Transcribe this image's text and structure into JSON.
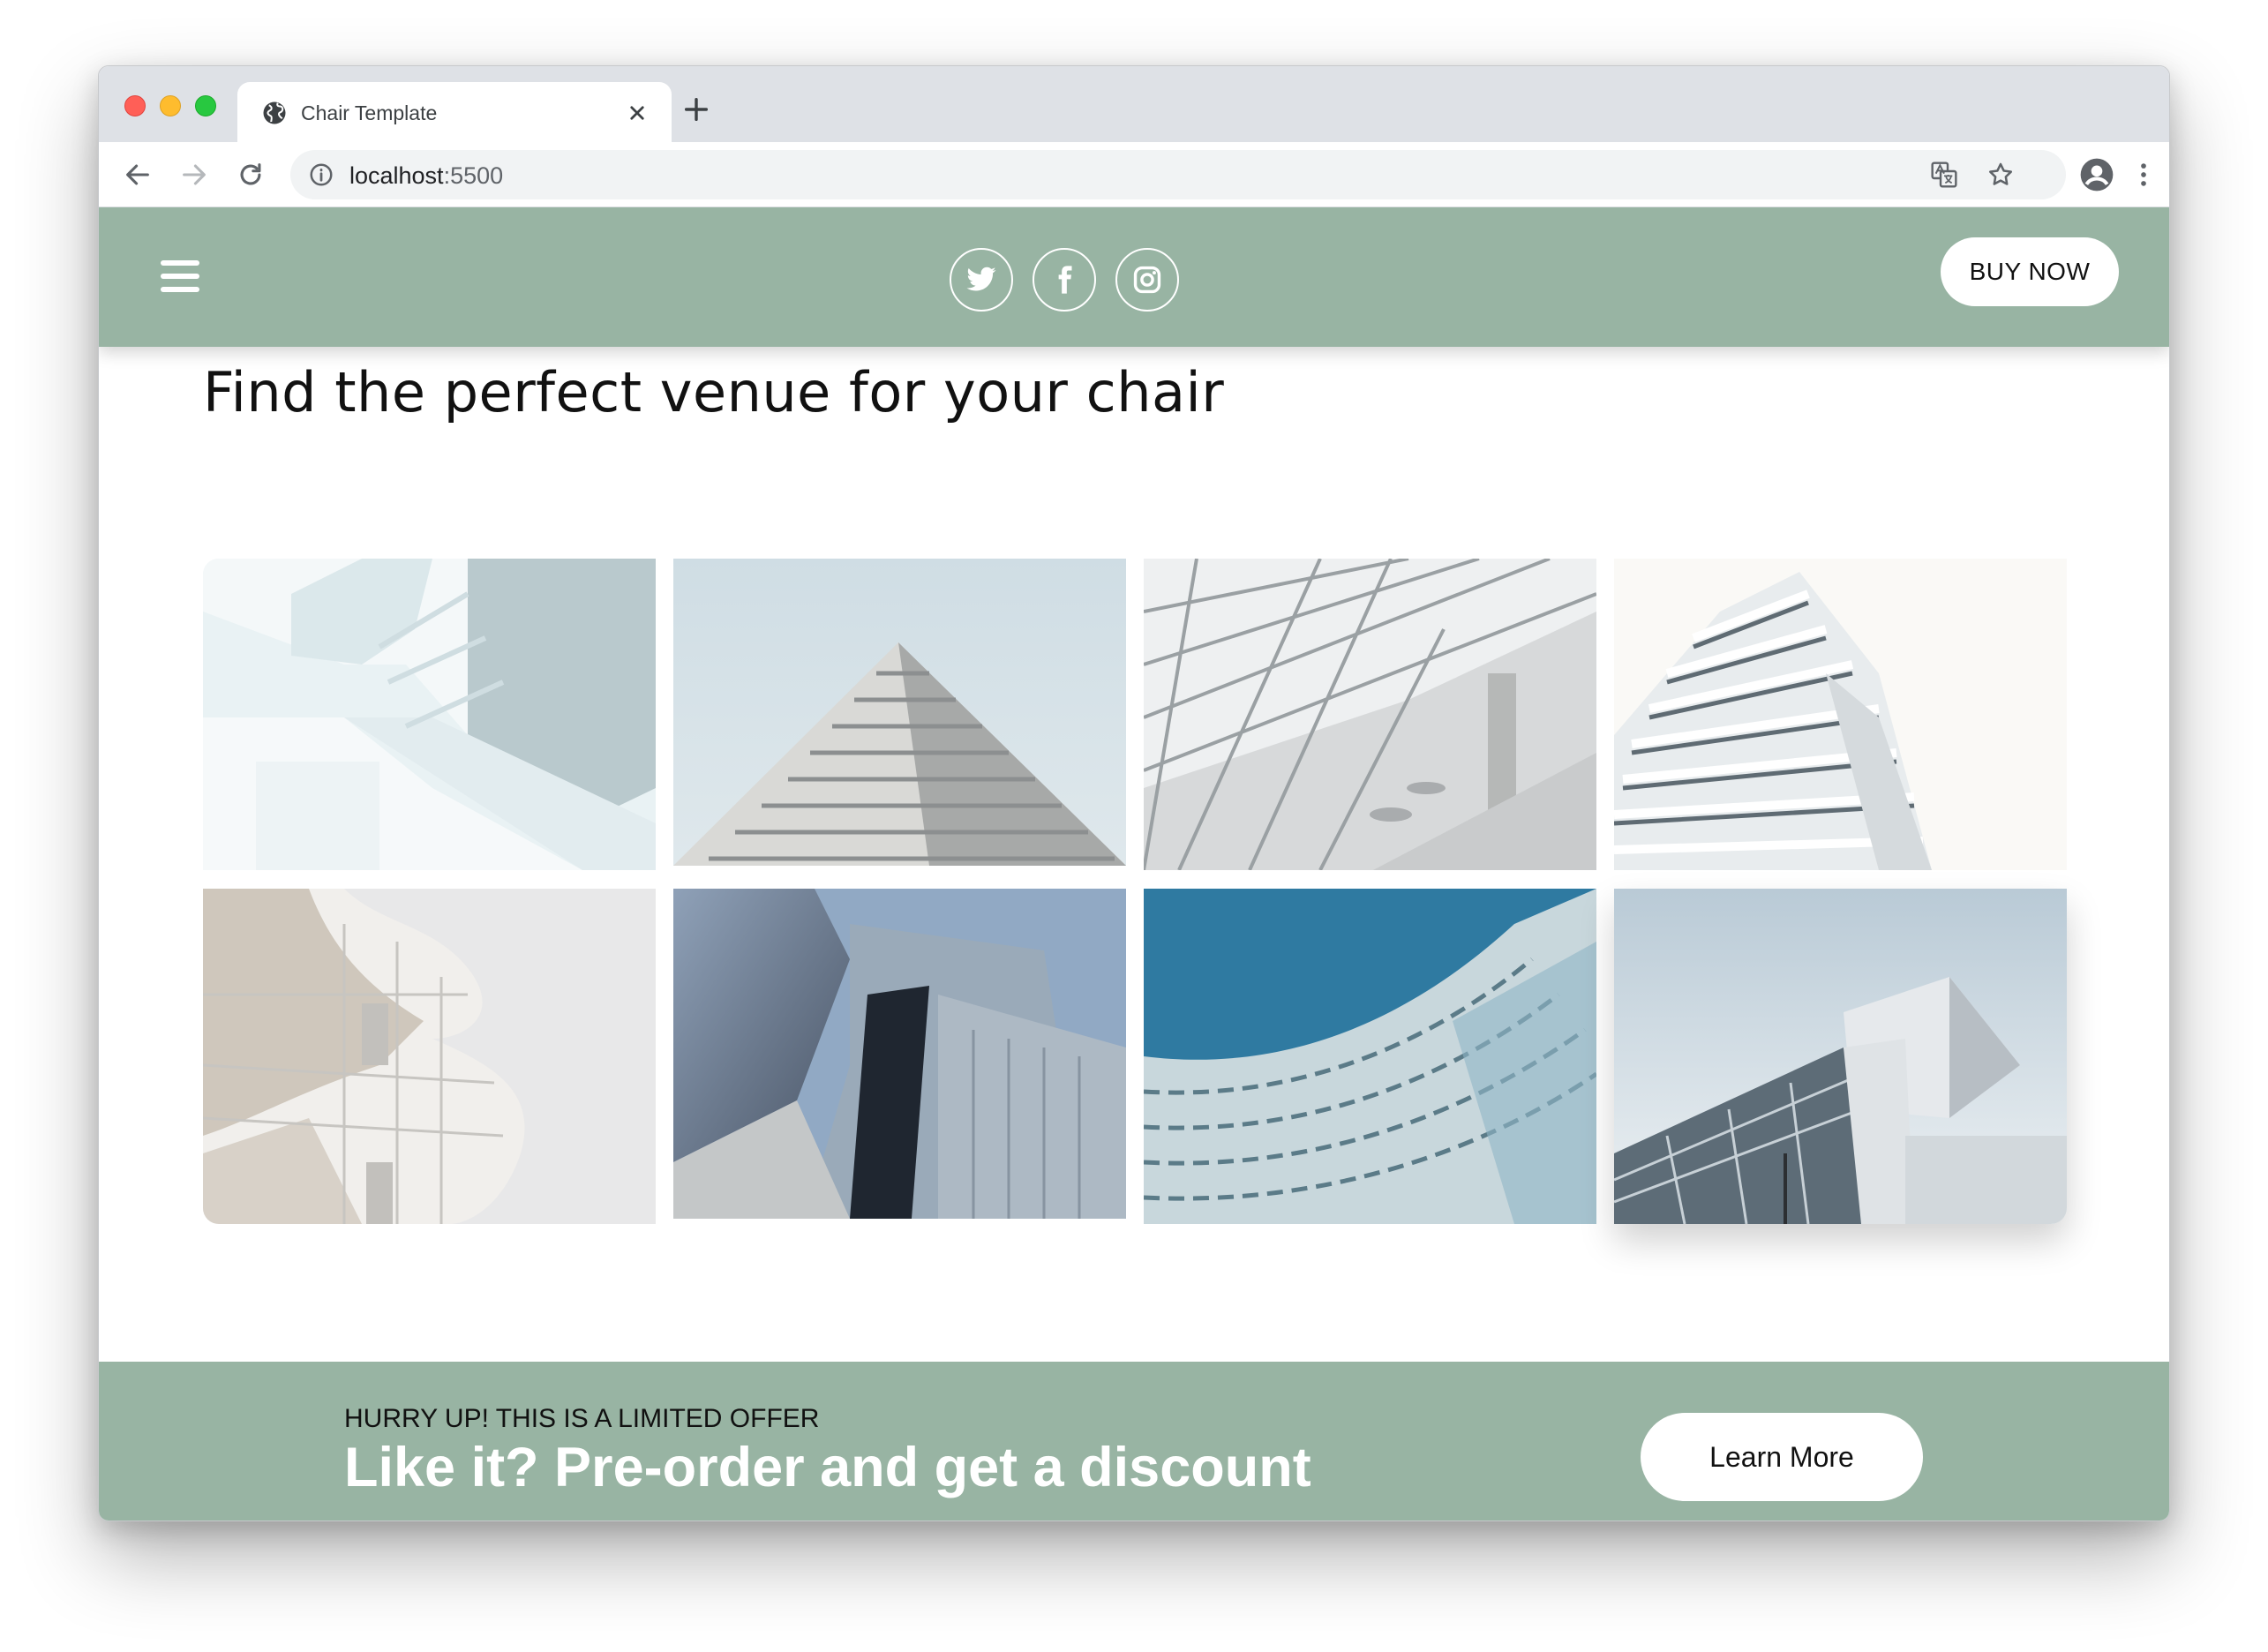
{
  "browser": {
    "tab_title": "Chair Template",
    "url_host": "localhost",
    "url_port": ":5500"
  },
  "header": {
    "buy_label": "BUY NOW",
    "socials": [
      "twitter-icon",
      "facebook-icon",
      "instagram-icon"
    ]
  },
  "main": {
    "heading": "Find the perfect venue for your chair",
    "gallery": [
      "white-staircase-photo",
      "stepped-tower-photo",
      "glass-atrium-photo",
      "balcony-tower-photo",
      "curved-white-building-photo",
      "metal-curved-building-photo",
      "woven-facade-photo",
      "cantilever-glass-building-photo"
    ]
  },
  "promo": {
    "kicker": "HURRY UP! THIS IS A LIMITED OFFER",
    "title": "Like it? Pre-order and get a discount",
    "button_label": "Learn More"
  },
  "colors": {
    "accent": "#98b4a3",
    "tabbar": "#dee1e6",
    "white": "#ffffff"
  }
}
